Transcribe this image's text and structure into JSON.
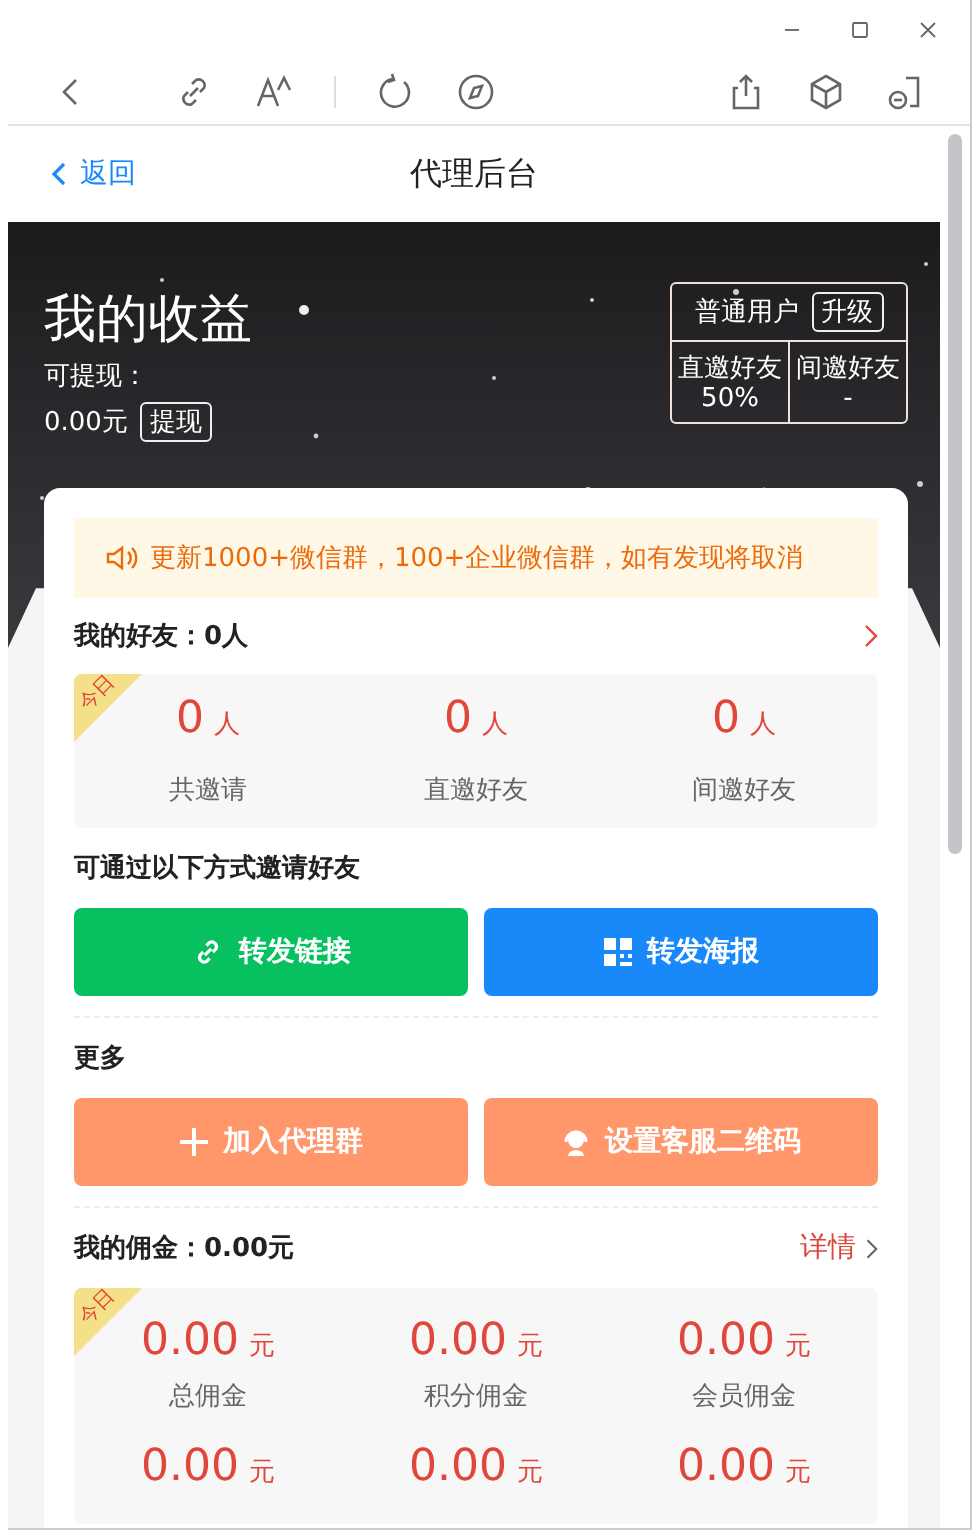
{
  "header": {
    "back": "返回",
    "title": "代理后台"
  },
  "hero": {
    "title": "我的收益",
    "withdrawable_label": "可提现：",
    "balance": "0.00元",
    "withdraw_button": "提现",
    "membership": {
      "level": "普通用户",
      "upgrade": "升级",
      "rates": [
        {
          "label": "直邀好友",
          "value": "50%"
        },
        {
          "label": "间邀好友",
          "value": "-"
        }
      ]
    }
  },
  "notice": "更新1000+微信群，100+企业微信群，如有发现将取消",
  "friends": {
    "title": "我的好友：0人",
    "ribbon": "今日",
    "stats": [
      {
        "value": "0",
        "unit": "人",
        "label": "共邀请"
      },
      {
        "value": "0",
        "unit": "人",
        "label": "直邀好友"
      },
      {
        "value": "0",
        "unit": "人",
        "label": "间邀好友"
      }
    ]
  },
  "invite": {
    "title": "可通过以下方式邀请好友",
    "buttons": [
      {
        "kind": "link",
        "label": "转发链接"
      },
      {
        "kind": "poster",
        "label": "转发海报"
      }
    ]
  },
  "more": {
    "title": "更多",
    "buttons": [
      {
        "kind": "group",
        "label": "加入代理群"
      },
      {
        "kind": "service",
        "label": "设置客服二维码"
      }
    ]
  },
  "commission": {
    "title": "我的佣金：0.00元",
    "detail": "详情",
    "ribbon": "今日",
    "stats": [
      {
        "value": "0.00",
        "unit": "元",
        "label": "总佣金"
      },
      {
        "value": "0.00",
        "unit": "元",
        "label": "积分佣金"
      },
      {
        "value": "0.00",
        "unit": "元",
        "label": "会员佣金"
      },
      {
        "value": "0.00",
        "unit": "元"
      },
      {
        "value": "0.00",
        "unit": "元"
      },
      {
        "value": "0.00",
        "unit": "元"
      }
    ]
  }
}
